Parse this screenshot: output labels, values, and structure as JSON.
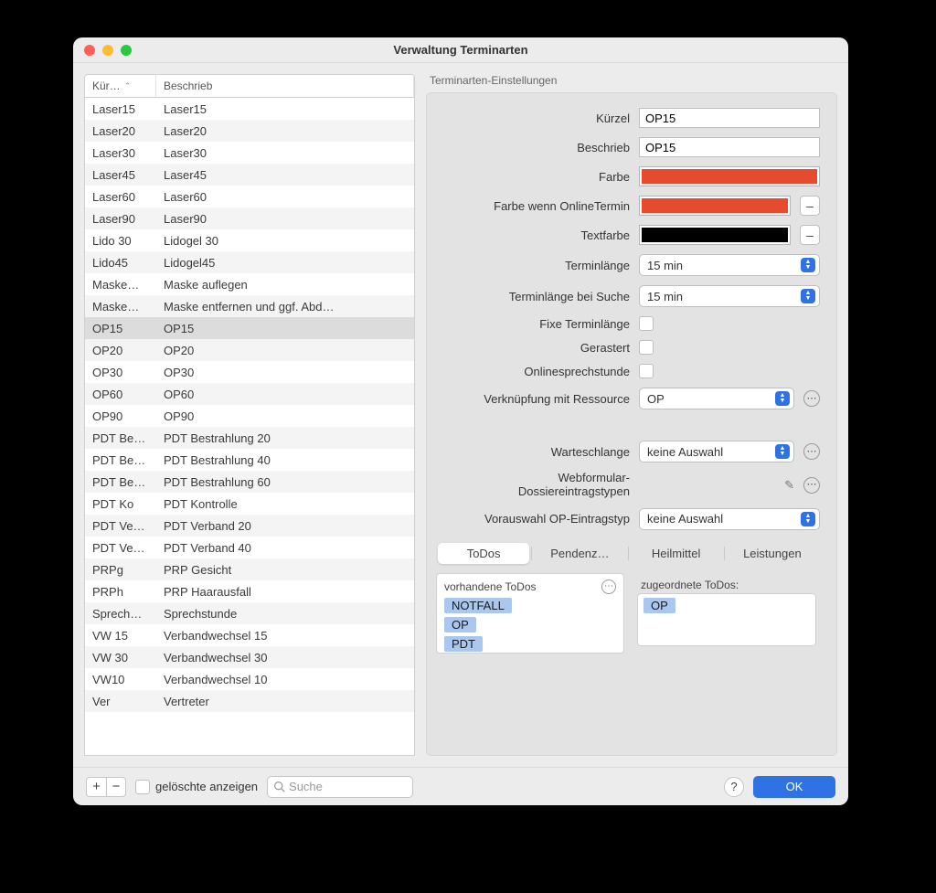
{
  "window": {
    "title": "Verwaltung Terminarten"
  },
  "table": {
    "header": {
      "col1": "Kür…",
      "col2": "Beschrieb"
    },
    "rows": [
      {
        "k": "Laser15",
        "b": "Laser15"
      },
      {
        "k": "Laser20",
        "b": "Laser20"
      },
      {
        "k": "Laser30",
        "b": "Laser30"
      },
      {
        "k": "Laser45",
        "b": "Laser45"
      },
      {
        "k": "Laser60",
        "b": "Laser60"
      },
      {
        "k": "Laser90",
        "b": "Laser90"
      },
      {
        "k": "Lido 30",
        "b": "Lidogel 30"
      },
      {
        "k": "Lido45",
        "b": "Lidogel45"
      },
      {
        "k": "Maske…",
        "b": "Maske auflegen"
      },
      {
        "k": "Maske…",
        "b": "Maske entfernen und ggf. Abd…"
      },
      {
        "k": "OP15",
        "b": "OP15",
        "selected": true
      },
      {
        "k": "OP20",
        "b": "OP20"
      },
      {
        "k": "OP30",
        "b": "OP30"
      },
      {
        "k": "OP60",
        "b": "OP60"
      },
      {
        "k": "OP90",
        "b": "OP90"
      },
      {
        "k": "PDT Be…",
        "b": "PDT Bestrahlung 20"
      },
      {
        "k": "PDT Be…",
        "b": "PDT Bestrahlung 40"
      },
      {
        "k": "PDT Be…",
        "b": "PDT Bestrahlung 60"
      },
      {
        "k": "PDT Ko",
        "b": "PDT Kontrolle"
      },
      {
        "k": "PDT Ve…",
        "b": "PDT Verband 20"
      },
      {
        "k": "PDT Ve…",
        "b": "PDT Verband 40"
      },
      {
        "k": "PRPg",
        "b": "PRP Gesicht"
      },
      {
        "k": "PRPh",
        "b": "PRP Haarausfall"
      },
      {
        "k": "Sprech…",
        "b": "Sprechstunde"
      },
      {
        "k": "VW 15",
        "b": "Verbandwechsel 15"
      },
      {
        "k": "VW 30",
        "b": "Verbandwechsel 30"
      },
      {
        "k": "VW10",
        "b": "Verbandwechsel 10"
      },
      {
        "k": "Ver",
        "b": " Vertreter"
      }
    ]
  },
  "settings": {
    "title": "Terminarten-Einstellungen",
    "kurzel_label": "Kürzel",
    "kurzel": "OP15",
    "beschrieb_label": "Beschrieb",
    "beschrieb": "OP15",
    "farbe_label": "Farbe",
    "farbe": "#e64a2f",
    "farbe_online_label": "Farbe wenn OnlineTermin",
    "farbe_online": "#e64a2f",
    "textfarbe_label": "Textfarbe",
    "textfarbe": "#000000",
    "terminlaenge_label": "Terminlänge",
    "terminlaenge": "15 min",
    "terminlaenge_suche_label": "Terminlänge bei Suche",
    "terminlaenge_suche": "15 min",
    "fixe_label": "Fixe Terminlänge",
    "gerastert_label": "Gerastert",
    "online_label": "Onlinesprechstunde",
    "ressource_label": "Verknüpfung mit Ressource",
    "ressource": "OP",
    "warteschlange_label": "Warteschlange",
    "warteschlange": "keine Auswahl",
    "webform_label1": "Webformular-",
    "webform_label2": "Dossiereintragstypen",
    "vorauswahl_label": "Vorauswahl OP-Eintragstyp",
    "vorauswahl": "keine Auswahl"
  },
  "tabs": {
    "todos": "ToDos",
    "pendenz": "Pendenz…",
    "heilmittel": "Heilmittel",
    "leistungen": "Leistungen"
  },
  "todos": {
    "vorhanden_title": "vorhandene ToDos",
    "zugeordnet_title": "zugeordnete ToDos:",
    "vorhanden": [
      "NOTFALL",
      "OP",
      "PDT"
    ],
    "zugeordnet": [
      "OP"
    ]
  },
  "bottom": {
    "deleted_label": "gelöschte anzeigen",
    "search_placeholder": "Suche",
    "ok": "OK",
    "help": "?",
    "plus": "+",
    "minus": "−",
    "dash": "–"
  }
}
